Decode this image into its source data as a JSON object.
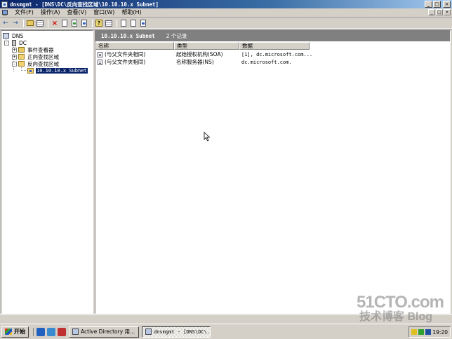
{
  "window": {
    "title": "dnsmgmt - [DNS\\DC\\反向查找区域\\10.10.10.x Subnet]",
    "min": "_",
    "max": "□",
    "close": "×"
  },
  "menu": {
    "items": [
      "文件(F)",
      "操作(A)",
      "查看(V)",
      "窗口(W)",
      "帮助(H)"
    ]
  },
  "toolbar": {
    "back": "←",
    "forward": "→",
    "delete": "×",
    "help": "?"
  },
  "tree": {
    "root": "DNS",
    "server": "DC",
    "event_viewer": "事件查看器",
    "forward_zones": "正向查找区域",
    "reverse_zones": "反向查找区域",
    "subnet": "10.10.10.x Subnet",
    "collapse": "-",
    "expand": "+"
  },
  "details": {
    "title": "10.10.10.x Subnet",
    "count": "2 个记录",
    "columns": [
      "名称",
      "类型",
      "数据"
    ],
    "rows": [
      {
        "name": "(与父文件夹相同)",
        "type": "起始授权机构(SOA)",
        "data": "[1], dc.microsoft.com..."
      },
      {
        "name": "(与父文件夹相同)",
        "type": "名称服务器(NS)",
        "data": "dc.microsoft.com."
      }
    ]
  },
  "taskbar": {
    "start": "开始",
    "tasks": [
      "Active Directory 用...",
      "dnsmgmt - [DNS\\DC\\..."
    ],
    "clock": "19:20"
  },
  "watermark": {
    "line1": "51CTO.com",
    "line2": "技术博客 Blog"
  },
  "colors": {
    "title_start": "#0a246a",
    "title_end": "#a6caf0",
    "selection": "#0a246a",
    "header_bar": "#808080",
    "chrome": "#d4d0c8"
  }
}
